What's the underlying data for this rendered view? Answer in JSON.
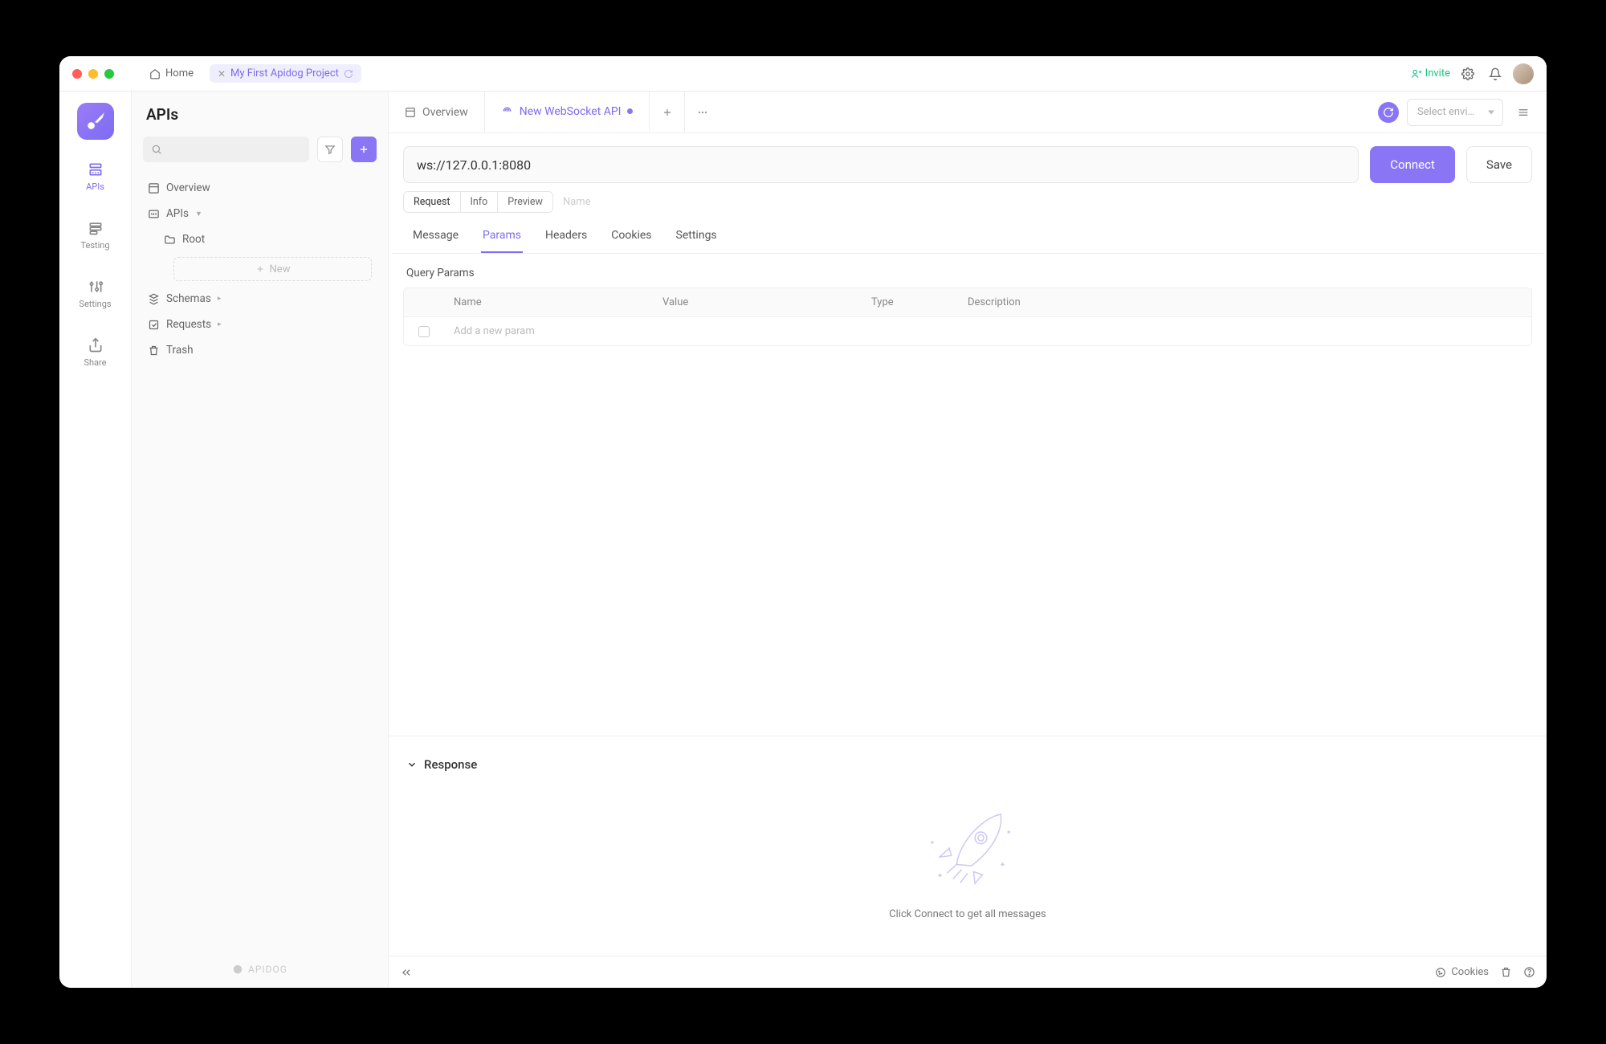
{
  "titlebar": {
    "home": "Home",
    "project": "My First Apidog Project",
    "invite": "Invite"
  },
  "rail": {
    "apis": "APIs",
    "testing": "Testing",
    "settings": "Settings",
    "share": "Share"
  },
  "sidebar": {
    "title": "APIs",
    "overview": "Overview",
    "apis": "APIs",
    "root": "Root",
    "new": "New",
    "schemas": "Schemas",
    "requests": "Requests",
    "trash": "Trash",
    "footer": "APIDOG"
  },
  "tabs": {
    "overview": "Overview",
    "current": "New WebSocket API"
  },
  "env": {
    "placeholder": "Select envi…"
  },
  "url": {
    "value": "ws://127.0.0.1:8080",
    "connect": "Connect",
    "save": "Save"
  },
  "segmented": {
    "request": "Request",
    "info": "Info",
    "preview": "Preview",
    "name_placeholder": "Name"
  },
  "subtabs": {
    "message": "Message",
    "params": "Params",
    "headers": "Headers",
    "cookies": "Cookies",
    "settings": "Settings"
  },
  "query": {
    "title": "Query Params",
    "cols": {
      "name": "Name",
      "value": "Value",
      "type": "Type",
      "desc": "Description"
    },
    "placeholder": "Add a new param"
  },
  "response": {
    "title": "Response",
    "empty": "Click Connect to get all messages"
  },
  "statusbar": {
    "cookies": "Cookies"
  }
}
